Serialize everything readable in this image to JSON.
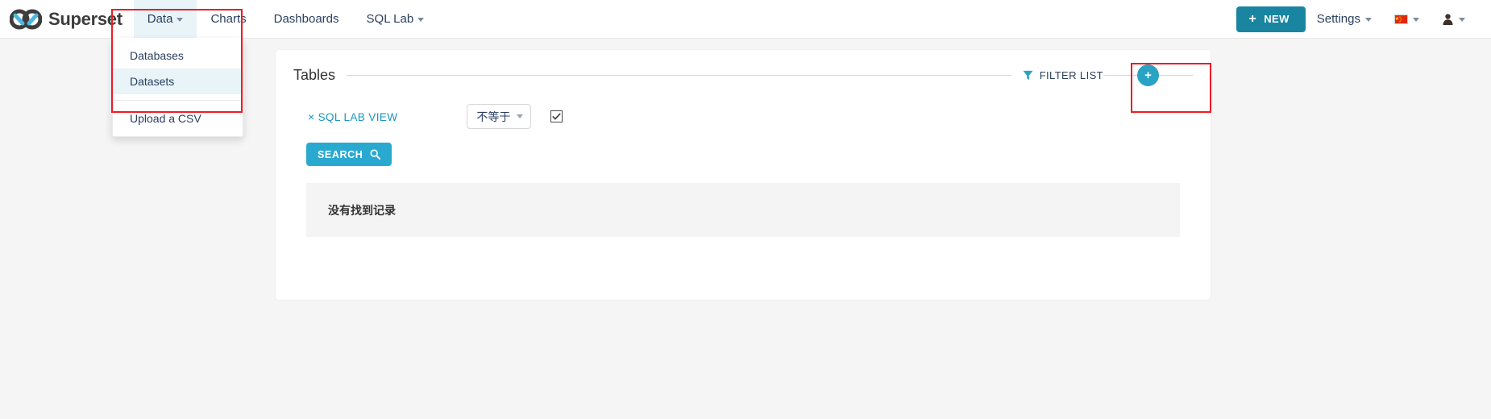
{
  "brand": {
    "name": "Superset",
    "logo_icon": "infinity-logo-icon"
  },
  "nav": {
    "items": [
      {
        "label": "Data",
        "has_caret": true,
        "active": true
      },
      {
        "label": "Charts",
        "has_caret": false,
        "active": false
      },
      {
        "label": "Dashboards",
        "has_caret": false,
        "active": false
      },
      {
        "label": "SQL Lab",
        "has_caret": true,
        "active": false
      }
    ]
  },
  "nav_right": {
    "new_button": {
      "label": "NEW",
      "plus": "+",
      "icon": "plus-icon",
      "color": "#1985a0"
    },
    "settings": {
      "label": "Settings",
      "icon": "chevron-down-icon"
    },
    "language": {
      "icon": "china-flag-icon"
    },
    "user": {
      "icon": "user-icon"
    }
  },
  "dropdown": {
    "items": [
      {
        "label": "Databases",
        "highlight": false
      },
      {
        "label": "Datasets",
        "highlight": true
      },
      {
        "label": "Upload a CSV",
        "highlight": false
      }
    ]
  },
  "main": {
    "title": "Tables",
    "filter_list": {
      "label": "FILTER LIST",
      "icon": "funnel-icon"
    },
    "add_button": {
      "label": "+",
      "icon": "plus-icon",
      "color": "#29a3c4"
    },
    "filter_row": {
      "remove": "×",
      "field_label": "SQL LAB VIEW",
      "operator_value": "不等于",
      "operator_caret": "chevron-down-icon",
      "checkbox_checked": true
    },
    "search_button": {
      "label": "SEARCH",
      "icon": "search-icon",
      "color": "#29a9d0"
    },
    "empty_message": "没有找到记录"
  },
  "annotations": {
    "nav_highlight_color": "#ee1c25",
    "add_highlight_color": "#ee1c25"
  }
}
